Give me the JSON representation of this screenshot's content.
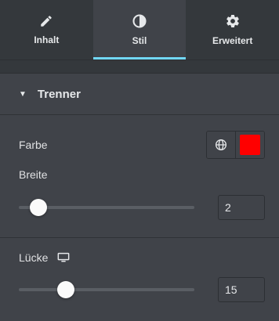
{
  "tabs": [
    {
      "label": "Inhalt",
      "icon": "pencil-icon",
      "active": false
    },
    {
      "label": "Stil",
      "icon": "contrast-icon",
      "active": true
    },
    {
      "label": "Erweitert",
      "icon": "gear-icon",
      "active": false
    }
  ],
  "section": {
    "title": "Trenner",
    "expanded": true
  },
  "color_control": {
    "label": "Farbe",
    "value": "#ff0000"
  },
  "width_control": {
    "label": "Breite",
    "value": "2",
    "slider_fraction": 0.11
  },
  "gap_control": {
    "label": "Lücke",
    "device_icon": "desktop-icon",
    "value": "15",
    "slider_fraction": 0.27
  },
  "colors": {
    "accent": "#71d7f7",
    "panel": "#404349",
    "tabbar": "#34383c"
  }
}
